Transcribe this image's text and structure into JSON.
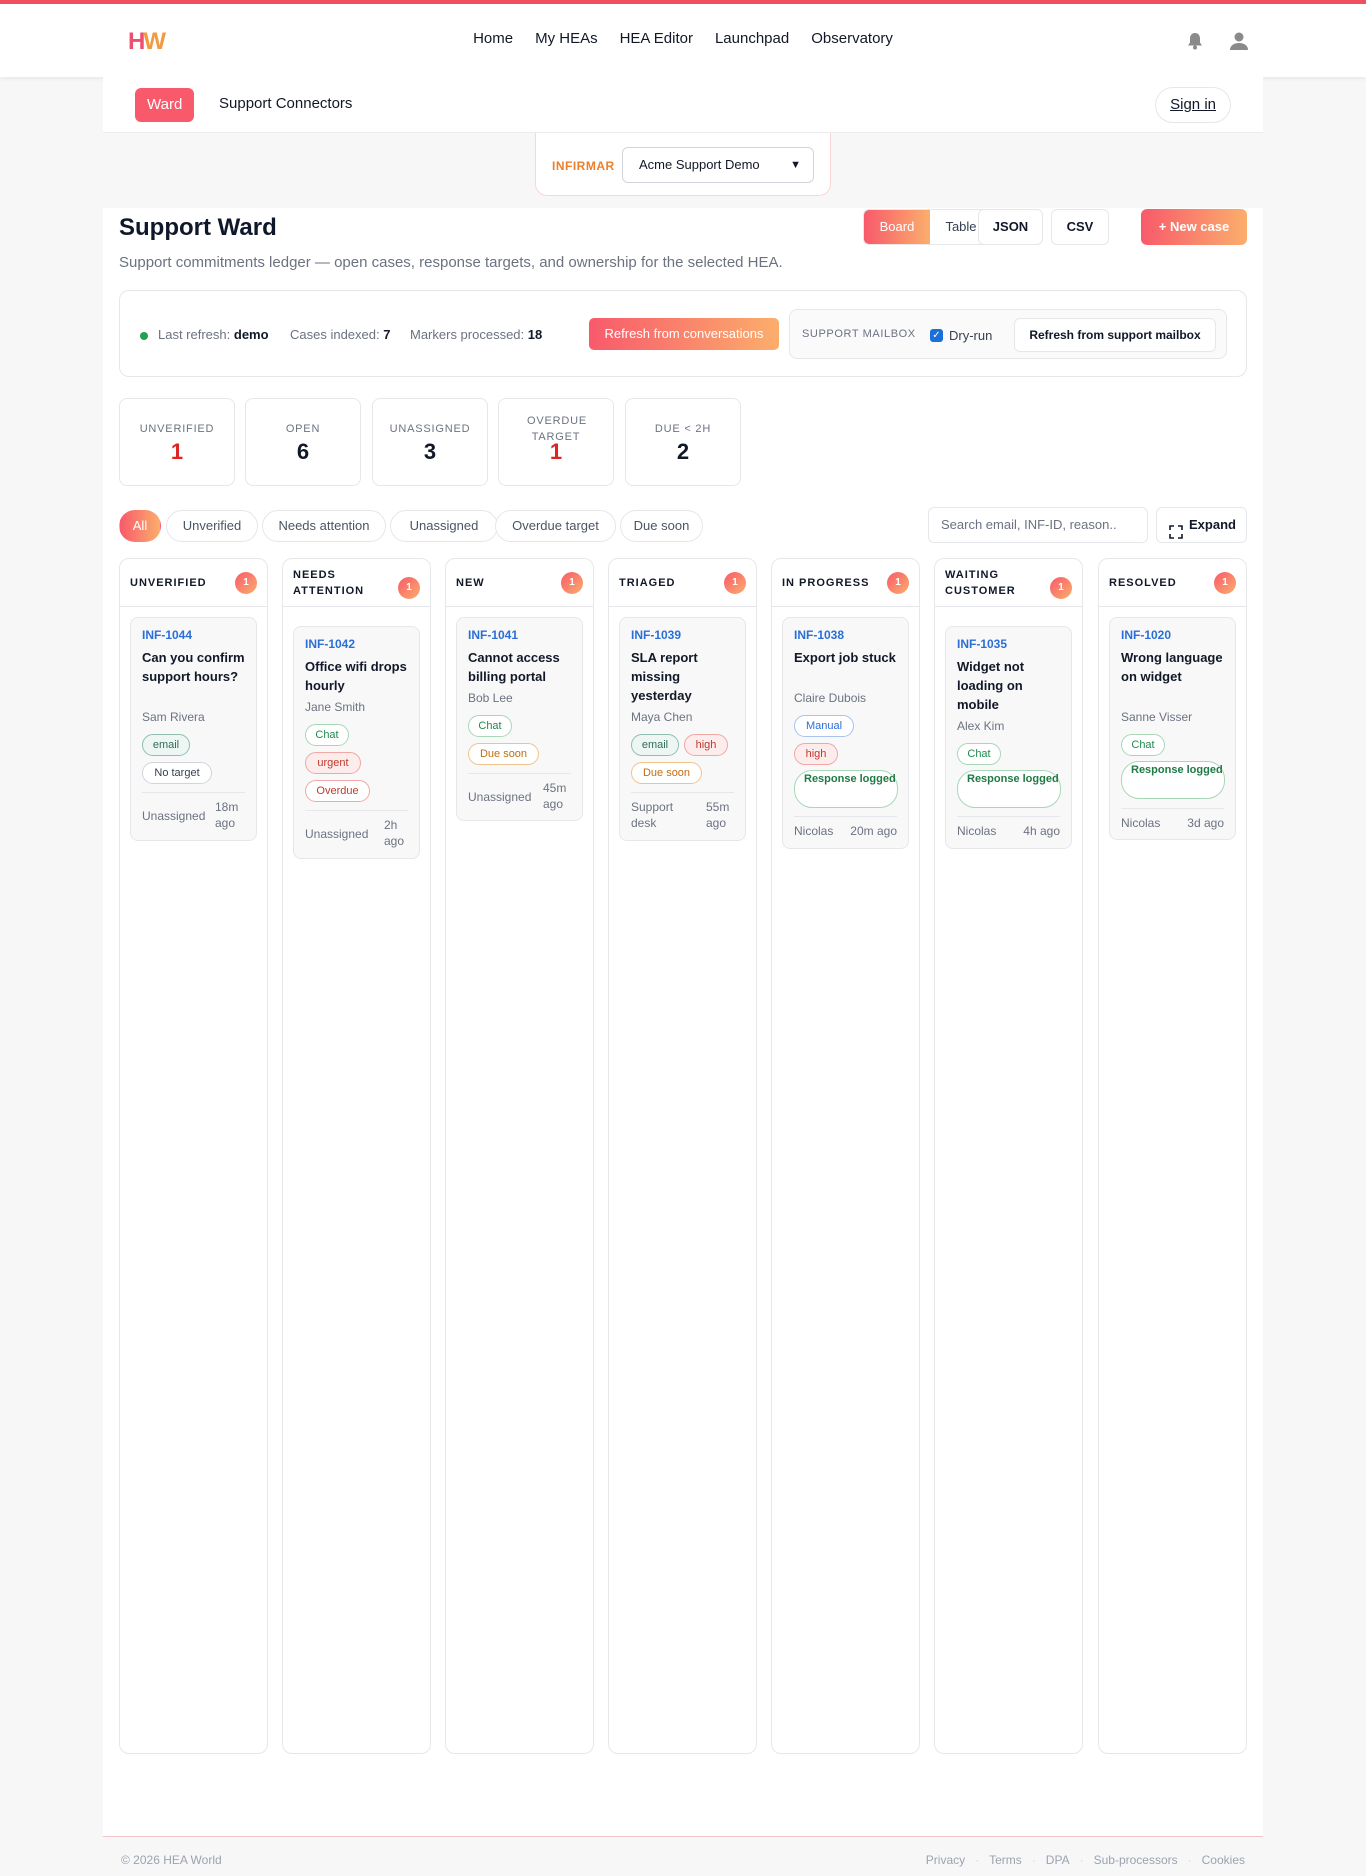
{
  "brand": {
    "logo_h": "H",
    "logo_w": "W"
  },
  "nav": {
    "home": "Home",
    "my_heas": "My HEAs",
    "hea_editor": "HEA Editor",
    "launchpad": "Launchpad",
    "observatory": "Observatory"
  },
  "icons": {
    "notifications": "bell-icon",
    "account": "user-icon",
    "expand": "expand-icon",
    "select": "chevron-down-icon"
  },
  "subnav": {
    "ward": "Ward",
    "connectors": "Support Connectors",
    "sign_in": "Sign in"
  },
  "picker": {
    "label": "INFIRMAR",
    "selected": "Acme Support Demo"
  },
  "page": {
    "title": "Support Ward",
    "subtitle": "Support commitments ledger — open cases, response targets, and ownership for the selected HEA.",
    "view_board": "Board",
    "view_table": "Table",
    "json": "JSON",
    "csv": "CSV",
    "new_case": "+ New case"
  },
  "status": {
    "last_refresh_label": "Last refresh:",
    "last_refresh_value": "demo",
    "cases_label": "Cases indexed:",
    "cases_value": "7",
    "markers_label": "Markers processed:",
    "markers_value": "18",
    "refresh_conversations": "Refresh from conversations",
    "mailbox_label": "SUPPORT MAILBOX",
    "dry_run": "Dry-run",
    "dry_run_checked": true,
    "refresh_mailbox": "Refresh from support mailbox"
  },
  "kpis": [
    {
      "label": "UNVERIFIED",
      "value": "1",
      "alert": true
    },
    {
      "label": "OPEN",
      "value": "6",
      "alert": false
    },
    {
      "label": "UNASSIGNED",
      "value": "3",
      "alert": false
    },
    {
      "label": "OVERDUE TARGET",
      "value": "1",
      "alert": true
    },
    {
      "label": "DUE < 2H",
      "value": "2",
      "alert": false
    }
  ],
  "filters": [
    "All",
    "Unverified",
    "Needs attention",
    "Unassigned",
    "Overdue target",
    "Due soon"
  ],
  "active_filter": "All",
  "search_placeholder": "Search email, INF-ID, reason..",
  "expand": "Expand",
  "columns": [
    {
      "title": "UNVERIFIED",
      "count": "1",
      "cards": [
        {
          "id": "INF-1044",
          "title": "Can you confirm support hours?",
          "name": "Sam Rivera",
          "tags": [
            "email",
            "No target"
          ],
          "owner": "Unassigned",
          "age": "18m ago"
        }
      ]
    },
    {
      "title": "NEEDS ATTENTION",
      "count": "1",
      "cards": [
        {
          "id": "INF-1042",
          "title": "Office wifi drops hourly",
          "name": "Jane Smith",
          "tags": [
            "Chat",
            "urgent",
            "Overdue"
          ],
          "owner": "Unassigned",
          "age": "2h ago"
        }
      ]
    },
    {
      "title": "NEW",
      "count": "1",
      "cards": [
        {
          "id": "INF-1041",
          "title": "Cannot access billing portal",
          "name": "Bob Lee",
          "tags": [
            "Chat",
            "Due soon"
          ],
          "owner": "Unassigned",
          "age": "45m ago"
        }
      ]
    },
    {
      "title": "TRIAGED",
      "count": "1",
      "cards": [
        {
          "id": "INF-1039",
          "title": "SLA report missing yesterday",
          "name": "Maya Chen",
          "tags": [
            "email",
            "high",
            "Due soon"
          ],
          "owner": "Support desk",
          "age": "55m ago"
        }
      ]
    },
    {
      "title": "IN PROGRESS",
      "count": "1",
      "cards": [
        {
          "id": "INF-1038",
          "title": "Export job stuck",
          "name": "Claire Dubois",
          "tags": [
            "Manual",
            "high",
            "Response logged"
          ],
          "owner": "Nicolas",
          "age": "20m ago"
        }
      ]
    },
    {
      "title": "WAITING CUSTOMER",
      "count": "1",
      "cards": [
        {
          "id": "INF-1035",
          "title": "Widget not loading on mobile",
          "name": "Alex Kim",
          "tags": [
            "Chat",
            "Response logged"
          ],
          "owner": "Nicolas",
          "age": "4h ago"
        }
      ]
    },
    {
      "title": "RESOLVED",
      "count": "1",
      "cards": [
        {
          "id": "INF-1020",
          "title": "Wrong language on widget",
          "name": "Sanne Visser",
          "tags": [
            "Chat",
            "Response logged"
          ],
          "owner": "Nicolas",
          "age": "3d ago"
        }
      ]
    }
  ],
  "footer": {
    "copyright": "© 2026 HEA World",
    "links": [
      "Privacy",
      "Terms",
      "DPA",
      "Sub-processors",
      "Cookies"
    ],
    "separator": "·"
  }
}
